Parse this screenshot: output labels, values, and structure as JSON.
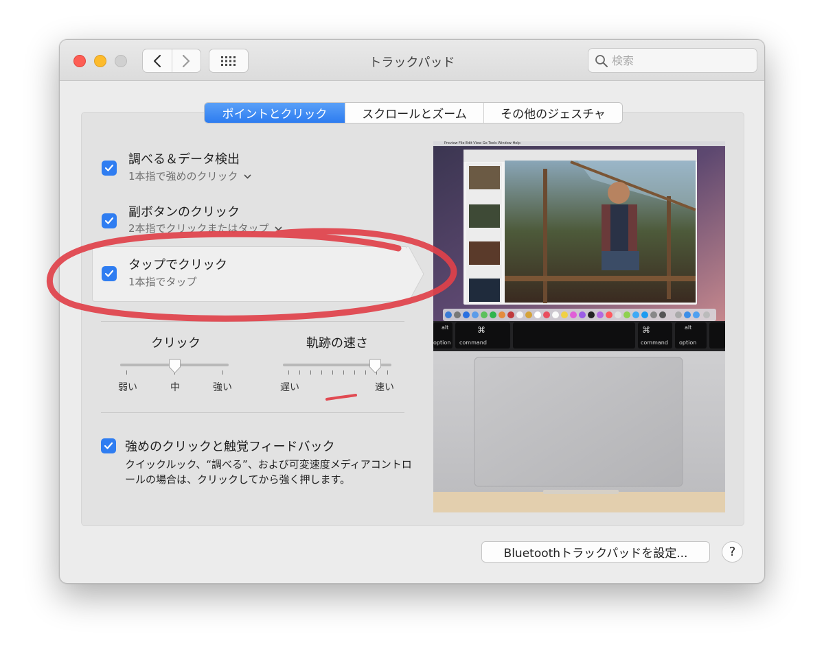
{
  "window": {
    "title": "トラックパッド",
    "search_placeholder": "検索"
  },
  "tabs": [
    {
      "label": "ポイントとクリック",
      "active": true
    },
    {
      "label": "スクロールとズーム",
      "active": false
    },
    {
      "label": "その他のジェスチャ",
      "active": false
    }
  ],
  "options": [
    {
      "title": "調べる＆データ検出",
      "subtitle": "1本指で強めのクリック",
      "checked": true,
      "has_dropdown": true
    },
    {
      "title": "副ボタンのクリック",
      "subtitle": "2本指でクリックまたはタップ",
      "checked": true,
      "has_dropdown": true
    },
    {
      "title": "タップでクリック",
      "subtitle": "1本指でタップ",
      "checked": true,
      "has_dropdown": false
    }
  ],
  "click_slider": {
    "title": "クリック",
    "labels": [
      "弱い",
      "中",
      "強い"
    ],
    "value_index": 1,
    "steps": 3
  },
  "tracking_slider": {
    "title": "軌跡の速さ",
    "min_label": "遅い",
    "max_label": "速い",
    "value_index": 8,
    "steps": 10
  },
  "force_click": {
    "title": "強めのクリックと触覚フィードバック",
    "checked": true,
    "description": "クイックルック、“調べる”、および可変速度メディアコントロールの場合は、クリックしてから強く押します。"
  },
  "preview": {
    "menubar": "Preview  File  Edit  View  Go  Tools  Window  Help",
    "key_left_top": "alt",
    "key_left_bottom": "option",
    "key_cmd_symbol": "⌘",
    "key_cmd_label": "command"
  },
  "buttons": {
    "bluetooth": "Bluetoothトラックパッドを設定...",
    "help": "?"
  },
  "colors": {
    "accent": "#2f7df1",
    "annotation": "#e0414a"
  }
}
